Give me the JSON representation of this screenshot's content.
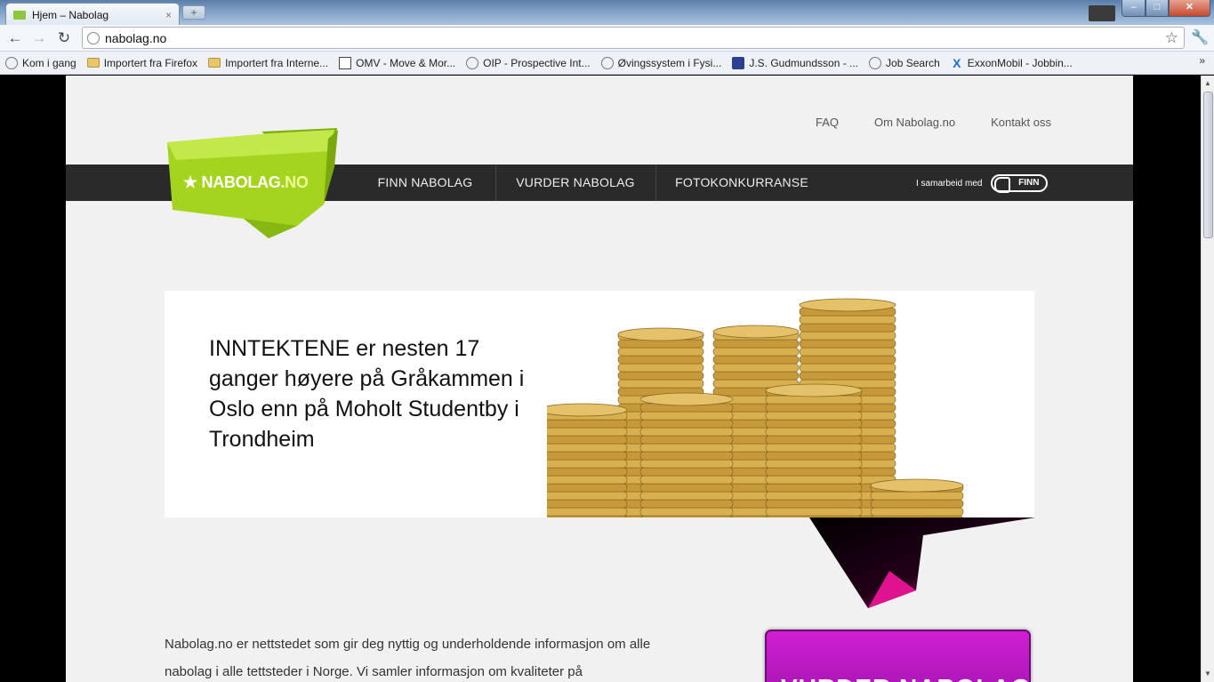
{
  "browser": {
    "tab_title": "Hjem – Nabolag",
    "tab_close": "×",
    "new_tab": "+",
    "url": "nabolag.no",
    "controls": {
      "minimize": "–",
      "maximize": "□",
      "close": "✕"
    },
    "bookmarks": [
      {
        "label": "Kom i gang",
        "icon": "globe-icon"
      },
      {
        "label": "Importert fra Firefox",
        "icon": "folder-icon"
      },
      {
        "label": "Importert fra Interne...",
        "icon": "folder-icon"
      },
      {
        "label": "OMV - Move & Mor...",
        "icon": "omv-icon"
      },
      {
        "label": "OIP - Prospective Int...",
        "icon": "globe-icon"
      },
      {
        "label": "Øvingssystem i Fysi...",
        "icon": "globe-icon"
      },
      {
        "label": "J.S. Gudmundsson - ...",
        "icon": "jsg-icon"
      },
      {
        "label": "Job Search",
        "icon": "globe-icon"
      },
      {
        "label": "ExxonMobil - Jobbin...",
        "icon": "exxon-icon"
      }
    ],
    "bookmarks_more": "»"
  },
  "site": {
    "logo_main": "★ NABOLAG.",
    "logo_suffix": "NO",
    "top_links": [
      "FAQ",
      "Om Nabolag.no",
      "Kontakt oss"
    ],
    "nav": [
      "FINN NABOLAG",
      "VURDER NABOLAG",
      "FOTOKONKURRANSE"
    ],
    "partner_text": "I samarbeid med",
    "partner_logo": "FINN",
    "banner_text": "INNTEKTENE er nesten 17 ganger høyere på Gråkammen i Oslo enn på Moholt Studentby i Trondheim",
    "intro_text": "Nabolag.no er nettstedet som gir deg nyttig og underholdende informasjon om alle nabolag i alle tettsteder i Norge. Vi samler informasjon om kvaliteter på",
    "cta_label": "VURDER NABOLAG",
    "colors": {
      "brand_green": "#9ccf1c",
      "nav_bg": "#2a2a2a",
      "cta_magenta": "#c01cc6",
      "tail_pink": "#e0138f"
    }
  }
}
